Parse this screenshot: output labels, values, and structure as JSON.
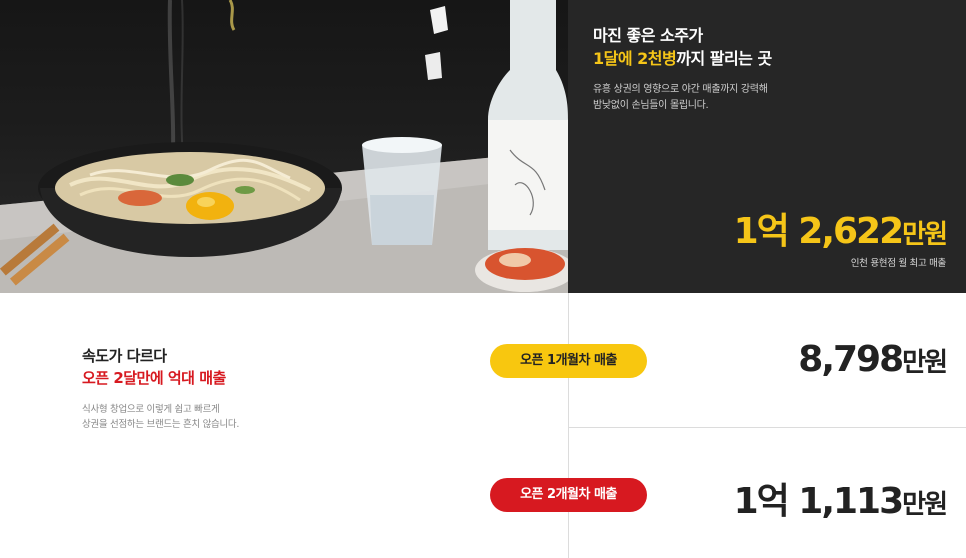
{
  "hero": {
    "headline_line1": "마진 좋은 소주가",
    "headline_line2_highlight": "1달에 2천병",
    "headline_line2_rest": "까지 팔리는 곳",
    "description_line1": "유흥 상권의 영향으로 야간 매출까지 강력해",
    "description_line2": "밤낮없이 손님들이 몰립니다.",
    "sales_number": "1억 2,622",
    "sales_unit": "만원",
    "sales_caption": "인천 용현점 월 최고 매출"
  },
  "section": {
    "title_line1": "속도가 다르다",
    "title_line2": "오픈 2달만에 억대 매출",
    "description_line1": "식사형 창업으로 이렇게 쉽고 빠르게",
    "description_line2": "상권을 선점하는 브랜드는 흔치 않습니다."
  },
  "stats": [
    {
      "label": "오픈 1개월차 매출",
      "value": "8,798",
      "unit": "만원"
    },
    {
      "label": "오픈 2개월차 매출",
      "value": "1억 1,113",
      "unit": "만원"
    }
  ],
  "colors": {
    "accent_yellow": "#f8c70f",
    "accent_red": "#d71920",
    "dark_panel": "#262626"
  }
}
